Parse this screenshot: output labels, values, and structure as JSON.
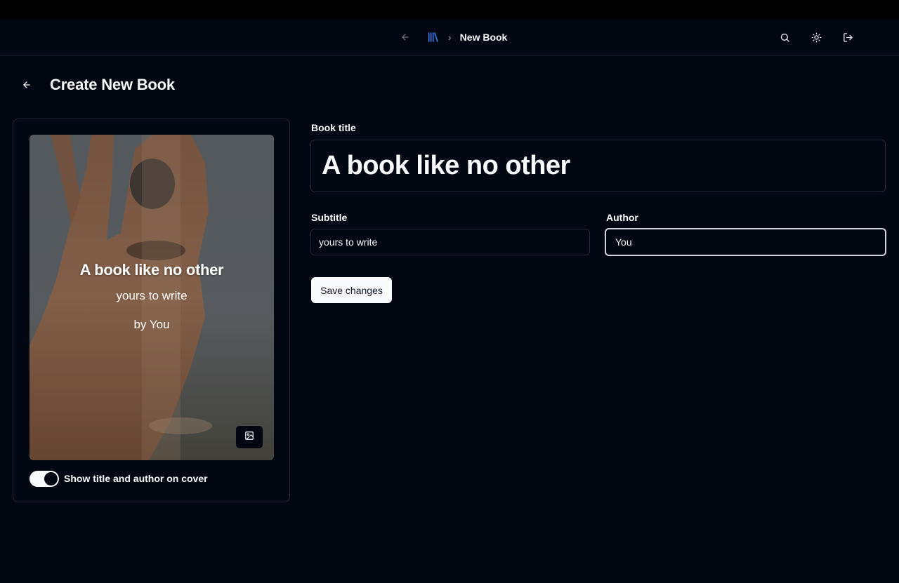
{
  "nav": {
    "title": "New Book",
    "separator": "›",
    "icons": [
      "arrow-left-icon",
      "library-icon",
      "search-icon",
      "sun-icon",
      "logout-icon"
    ]
  },
  "page": {
    "title": "Create New Book"
  },
  "cover": {
    "title": "A book like no other",
    "subtitle": "yours to write",
    "author": "by You",
    "toggle_label": "Show title and author on cover",
    "toggle_on": true
  },
  "form": {
    "book_title_label": "Book title",
    "book_title_value": "A book like no other",
    "subtitle_label": "Subtitle",
    "subtitle_value": "yours to write",
    "author_label": "Author",
    "author_value": "You",
    "save_label": "Save changes"
  },
  "colors": {
    "background": "#030712",
    "border": "#1f2937",
    "foreground": "#f9fafb",
    "accent": "#3b82f6"
  }
}
